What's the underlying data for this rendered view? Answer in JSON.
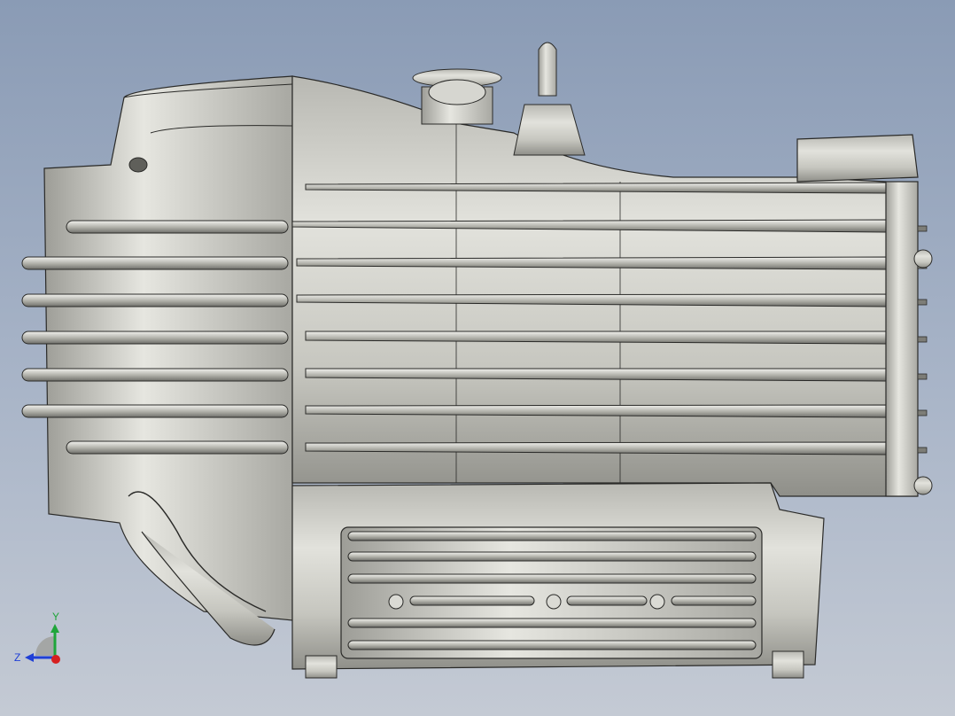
{
  "viewport": {
    "background_top": "#8a9bb5",
    "background_bottom": "#c4cad4",
    "model_fill": "#c9c9c2",
    "model_shade": "#8e8e88",
    "edge_color": "#2a2a28"
  },
  "triad": {
    "y_label": "Y",
    "z_label": "Z",
    "y_color": "#1fa53a",
    "z_color": "#1f3fd6",
    "x_color": "#d61f1f"
  }
}
